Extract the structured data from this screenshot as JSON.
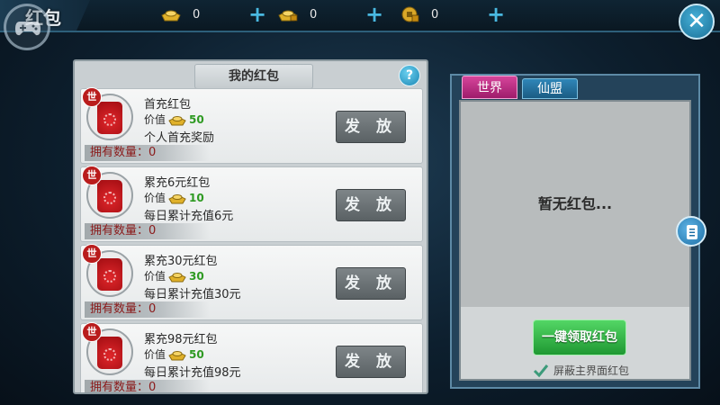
{
  "header": {
    "title": "红包",
    "currencies": [
      {
        "icon": "gold-ingot-icon",
        "value": "0"
      },
      {
        "icon": "bound-ingot-icon",
        "value": "0"
      },
      {
        "icon": "coin-lock-icon",
        "value": "0"
      }
    ],
    "plus": "+",
    "close": "✕"
  },
  "left_panel": {
    "title": "我的红包",
    "help": "?",
    "badge": "世",
    "value_label": "价值",
    "owned_label": "拥有数量：",
    "send_label": "发 放",
    "items": [
      {
        "name": "首充红包",
        "value": "50",
        "desc": "个人首充奖励",
        "owned": "0"
      },
      {
        "name": "累充6元红包",
        "value": "10",
        "desc": "每日累计充值6元",
        "owned": "0"
      },
      {
        "name": "累充30元红包",
        "value": "30",
        "desc": "每日累计充值30元",
        "owned": "0"
      },
      {
        "name": "累充98元红包",
        "value": "50",
        "desc": "每日累计充值98元",
        "owned": "0"
      }
    ]
  },
  "right_panel": {
    "tabs": [
      "世界",
      "仙盟"
    ],
    "empty_text": "暂无红包...",
    "claim_all": "一键领取红包",
    "block_label": "屏蔽主界面红包"
  },
  "colors": {
    "accent_blue": "#49b8e0",
    "world_tab": "#c2338a",
    "claim_green": "#2fb446",
    "value_green": "#2e9a22",
    "owned_red": "#8b1b1b"
  }
}
